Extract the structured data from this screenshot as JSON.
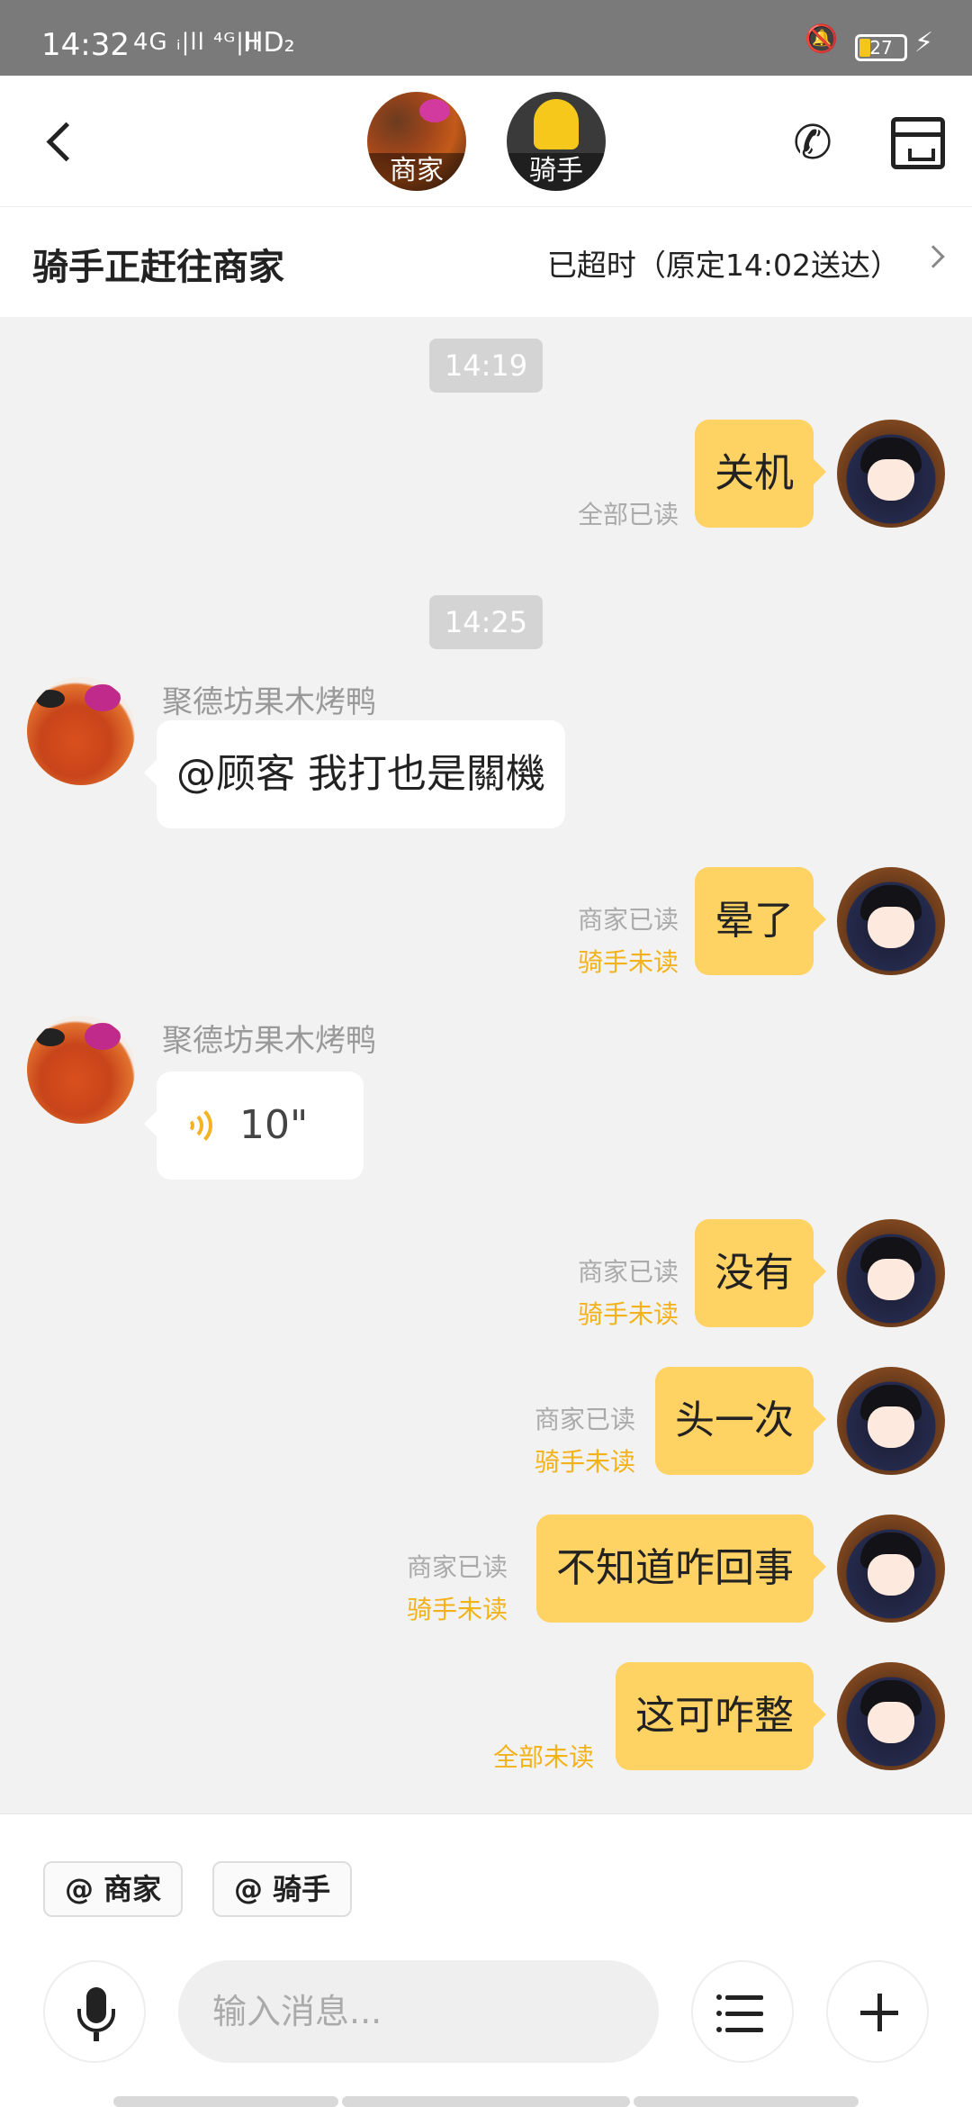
{
  "status_bar": {
    "time": "14:32",
    "network": "4G ᵢ|ll ⁴ᴳ|ll",
    "hd": "HD₂",
    "battery": "27"
  },
  "header": {
    "merchant_label": "商家",
    "rider_label": "骑手"
  },
  "order": {
    "status": "骑手正赶往商家",
    "overtime": "已超时（原定14:02送达）"
  },
  "chat": {
    "times": [
      "14:19",
      "14:25"
    ],
    "merchant_name": "聚德坊果木烤鸭",
    "messages": [
      {
        "text": "关机",
        "read1": "全部已读",
        "read2": ""
      },
      {
        "text": "@顾客 我打也是關機"
      },
      {
        "text": "晕了",
        "read1": "商家已读",
        "read2": "骑手未读"
      },
      {
        "voice_length": "10\""
      },
      {
        "text": "没有",
        "read1": "商家已读",
        "read2": "骑手未读"
      },
      {
        "text": "头一次",
        "read1": "商家已读",
        "read2": "骑手未读"
      },
      {
        "text": "不知道咋回事",
        "read1": "商家已读",
        "read2": "骑手未读"
      },
      {
        "text": "这可咋整",
        "read1": "全部未读",
        "read2": ""
      }
    ]
  },
  "bottom": {
    "at_merchant": "@ 商家",
    "at_rider": "@ 骑手",
    "input_placeholder": "输入消息..."
  },
  "colors": {
    "my_bubble": "#ffd264",
    "unread_gold": "#f3b21a",
    "read_grey": "#aaaaaa"
  }
}
